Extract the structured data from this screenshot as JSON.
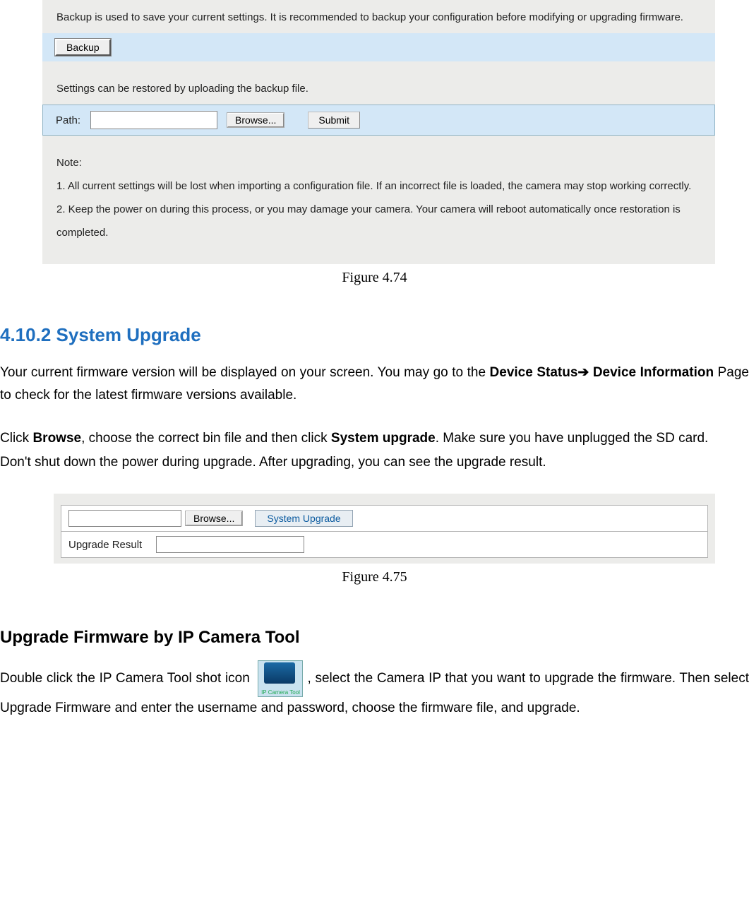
{
  "figure1": {
    "intro_line": "Backup is used to save your current settings. It is recommended to backup your configuration before modifying or upgrading firmware.",
    "backup_button": "Backup",
    "restore_line": "Settings can be restored by uploading the backup file.",
    "path_label": "Path:",
    "path_value": "",
    "browse_button": "Browse...",
    "submit_button": "Submit",
    "note_title": "Note:",
    "note_1": "1. All current settings will be lost when importing a configuration file. If an incorrect file is loaded, the camera may stop working correctly.",
    "note_2": "2. Keep the power on during this process, or you may damage your camera. Your camera will reboot automatically once restoration is completed.",
    "caption": "Figure 4.74"
  },
  "section": {
    "heading": "4.10.2    System Upgrade",
    "para1_a": "Your current firmware version will be displayed on your screen. You may go to the ",
    "para1_b1": "Device Status",
    "para1_arrow": "➔",
    "para1_b2": " Device Information",
    "para1_c": " Page to check for the latest firmware versions available.",
    "para2_a": "Click ",
    "para2_b1": "Browse",
    "para2_c": ", choose the correct bin file and then click ",
    "para2_b2": "System upgrade",
    "para2_d": ". Make sure you have unplugged the SD card.",
    "para3": "Don't shut down the power during upgrade. After upgrading, you can see the upgrade result."
  },
  "figure2": {
    "file_value": "",
    "browse_button": "Browse...",
    "sys_upgrade_button": "System Upgrade",
    "result_label": "Upgrade Result",
    "result_value": "",
    "caption": "Figure 4.75"
  },
  "section2": {
    "heading": "Upgrade Firmware by IP Camera Tool",
    "para_a": "Double click the IP Camera Tool shot icon ",
    "icon_label": "IP Camera Tool",
    "para_b": ", select the Camera IP that you want to upgrade the firmware. Then select Upgrade Firmware and enter the username and password, choose the firmware file, and upgrade."
  }
}
